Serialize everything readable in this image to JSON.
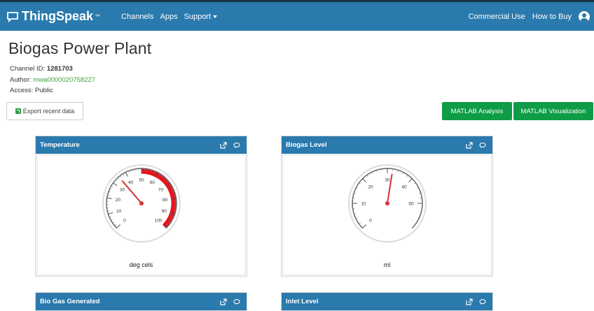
{
  "nav": {
    "brand": "ThingSpeak",
    "brand_mark": "™",
    "links": [
      "Channels",
      "Apps",
      "Support"
    ],
    "right_links": [
      "Commercial Use",
      "How to Buy"
    ]
  },
  "channel": {
    "title": "Biogas Power Plant",
    "id_label": "Channel ID:",
    "id_value": "1281703",
    "author_label": "Author:",
    "author_value": "mwa0000020758227",
    "access_label": "Access:",
    "access_value": "Public"
  },
  "actions": {
    "export_label": "Export recent data",
    "matlab_analysis": "MATLAB Analysis",
    "matlab_visualization": "MATLAB Visualization"
  },
  "panels": [
    {
      "title": "Temperature",
      "unit": "deg cels",
      "gauge": {
        "min": 0,
        "max": 100,
        "ticks": [
          "0",
          "10",
          "20",
          "30",
          "40",
          "50",
          "60",
          "70",
          "80",
          "90",
          "100"
        ],
        "value": 35,
        "danger_from": 50,
        "danger_to": 100
      }
    },
    {
      "title": "Biogas Level",
      "unit": "ml",
      "gauge": {
        "min": 0,
        "max": 60,
        "ticks": [
          "0",
          "10",
          "20",
          "30",
          "40",
          "50"
        ],
        "value": 32
      }
    },
    {
      "title": "Bio Gas Generated"
    },
    {
      "title": "Inlet Level"
    }
  ],
  "colors": {
    "nav": "#2a7aad",
    "green": "#0e9c46",
    "danger": "#e8141c",
    "needle": "#d9303a"
  }
}
